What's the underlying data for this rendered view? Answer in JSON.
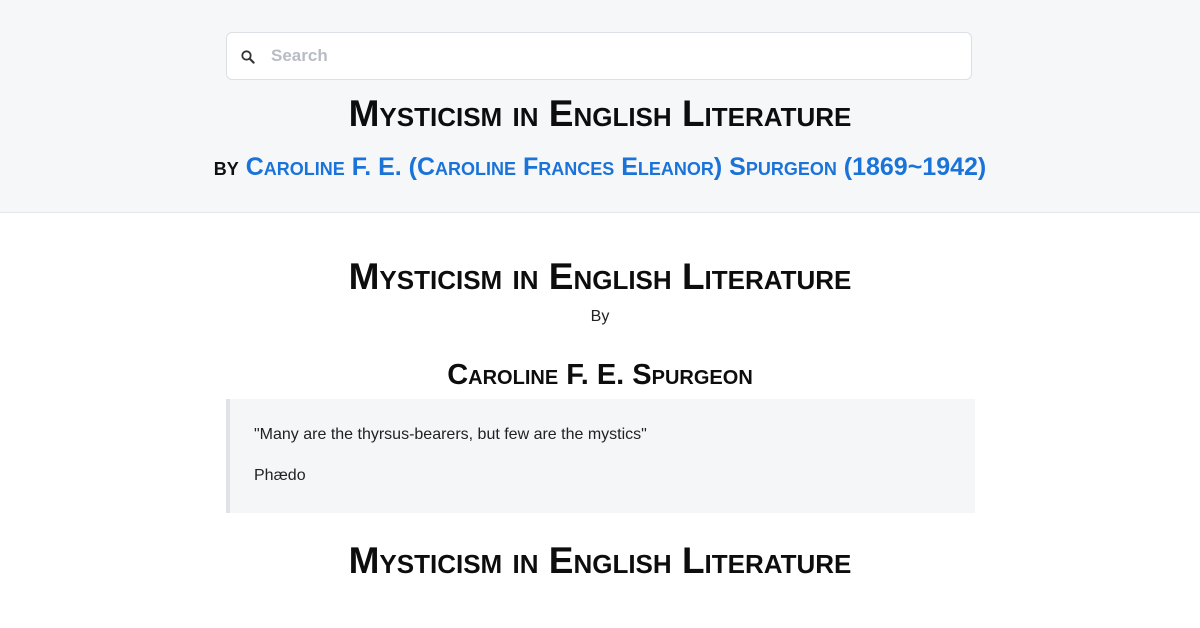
{
  "search": {
    "placeholder": "Search",
    "icon": "search-icon"
  },
  "header": {
    "title": "Mysticism in English Literature",
    "byline_prefix": "by",
    "author_link": "Caroline F. E. (Caroline Frances Eleanor) Spurgeon (1869~1942)"
  },
  "content": {
    "title": "Mysticism in English Literature",
    "by_label": "By",
    "author": "Caroline F. E. Spurgeon",
    "epigraph": {
      "quote": "\"Many are the thyrsus-bearers, but few are the mystics\"",
      "source": "Phædo"
    },
    "chapter_title": "Mysticism in English Literature"
  },
  "colors": {
    "header_bg": "#f6f7f9",
    "link": "#1a73d9",
    "epigraph_bg": "#f5f6f8"
  }
}
